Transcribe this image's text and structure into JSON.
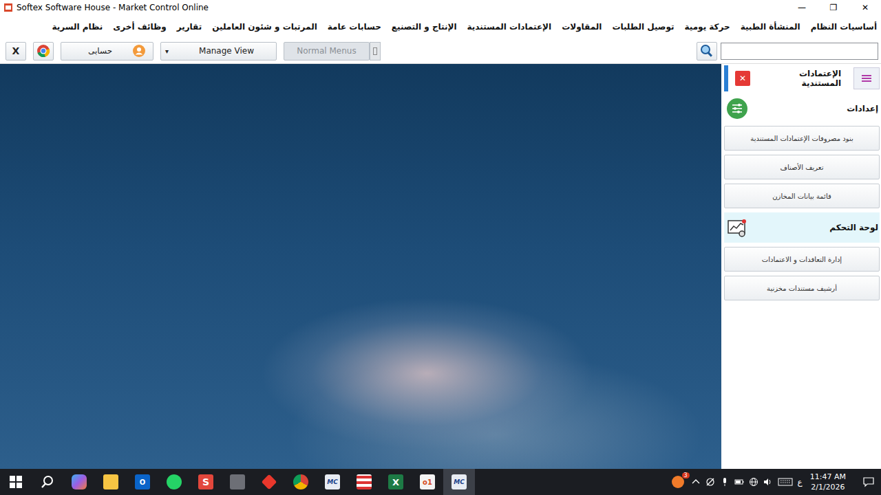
{
  "window": {
    "title": "Softex Software House - Market Control Online",
    "controls": [
      "—",
      "❐",
      "✕"
    ]
  },
  "menu": [
    {
      "label": "أساسيات النظام"
    },
    {
      "label": "المنشأة الطبية"
    },
    {
      "label": "حركة يومية"
    },
    {
      "label": "توصيل الطلبات"
    },
    {
      "label": "المقاولات"
    },
    {
      "label": "الإعتمادات المستندية"
    },
    {
      "label": "الإنتاج و التصنيع"
    },
    {
      "label": "حسابات عامة"
    },
    {
      "label": "المرتبات و شئون العاملين"
    },
    {
      "label": "تقارير"
    },
    {
      "label": "وظائف أخرى"
    },
    {
      "label": "نظام السرية"
    }
  ],
  "toolbar": {
    "close": "X",
    "account": "حسابى",
    "view": "Manage View",
    "view_arrow": "▾",
    "menus": {
      "label": "Normal Menus",
      "disabled": true
    },
    "search": {
      "value": ""
    }
  },
  "sidebar": {
    "title": "الإعتمادات المستندية",
    "close": "✕",
    "sections": [
      {
        "title": "إعدادات",
        "kind": "settings",
        "hovered": false,
        "items": [
          "بنود مصروفات الإعتمادات المستندية",
          "تعريف الأصناف",
          "قائمة بيانات المخازن"
        ]
      },
      {
        "title": "لوحة التحكم",
        "kind": "dashboard",
        "hovered": true,
        "items": [
          "إدارة التعاقدات و الاعتمادات",
          "أرشيف مستندات مخزنية"
        ]
      }
    ]
  },
  "taskbar": {
    "apps": [
      {
        "kind": "copilot",
        "glyph": "",
        "active": false
      },
      {
        "kind": "folder",
        "glyph": "",
        "active": false
      },
      {
        "kind": "outlook",
        "glyph": "O",
        "active": false
      },
      {
        "kind": "whatsapp",
        "glyph": "",
        "active": false
      },
      {
        "kind": "sapp",
        "glyph": "S",
        "active": false
      },
      {
        "kind": "calc",
        "glyph": "",
        "active": false
      },
      {
        "kind": "anydesk",
        "glyph": "",
        "active": false
      },
      {
        "kind": "chrome",
        "glyph": "",
        "active": false
      },
      {
        "kind": "mc",
        "glyph": "MC",
        "active": false
      },
      {
        "kind": "tool",
        "glyph": "",
        "active": false
      },
      {
        "kind": "excel",
        "glyph": "X",
        "active": false
      },
      {
        "kind": "office",
        "glyph": "o1",
        "active": false
      },
      {
        "kind": "mc",
        "glyph": "MC",
        "active": true
      }
    ],
    "tray": {
      "badge": "3",
      "language": "ع",
      "time": "11:47 AM",
      "date": "2/1/2026"
    }
  }
}
